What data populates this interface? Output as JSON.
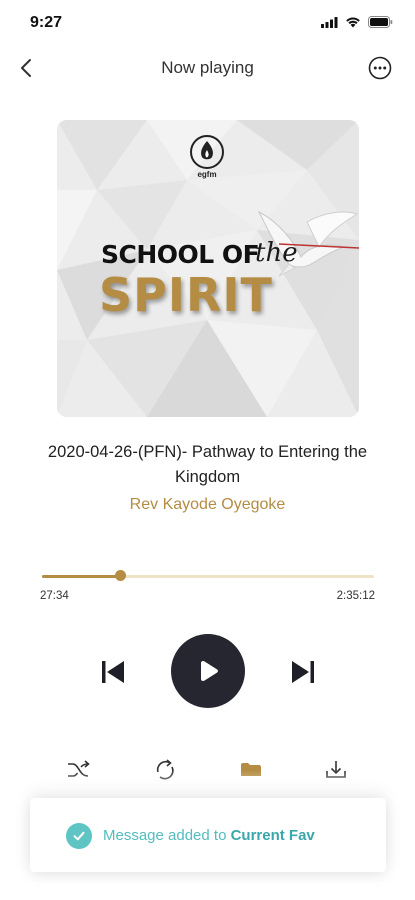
{
  "status_bar": {
    "time": "9:27",
    "icons": [
      "signal-icon",
      "wifi-icon",
      "battery-icon"
    ]
  },
  "header": {
    "title": "Now playing",
    "back_icon": "chevron-left-icon",
    "more_icon": "more-horizontal-icon"
  },
  "artwork": {
    "logo_text": "egfm",
    "line1": "SCHOOL OF",
    "line_the": "the",
    "line2": "SPIRIT"
  },
  "track": {
    "title": "2020-04-26-(PFN)- Pathway to Entering the Kingdom",
    "artist": "Rev Kayode Oyegoke"
  },
  "progress": {
    "elapsed": "27:34",
    "total": "2:35:12",
    "fraction": 0.236
  },
  "controls": {
    "prev_icon": "skip-previous-icon",
    "play_icon": "play-icon",
    "next_icon": "skip-next-icon"
  },
  "actions": [
    "shuffle-icon",
    "repeat-icon",
    "favorite-folder-icon",
    "download-icon"
  ],
  "toast": {
    "message_prefix": "Message added to",
    "playlist": "Current Fav"
  },
  "colors": {
    "accent": "#b48c43",
    "progress_track": "#f0e2c4",
    "play_button": "#262631",
    "toast_text": "#52bcbf"
  }
}
